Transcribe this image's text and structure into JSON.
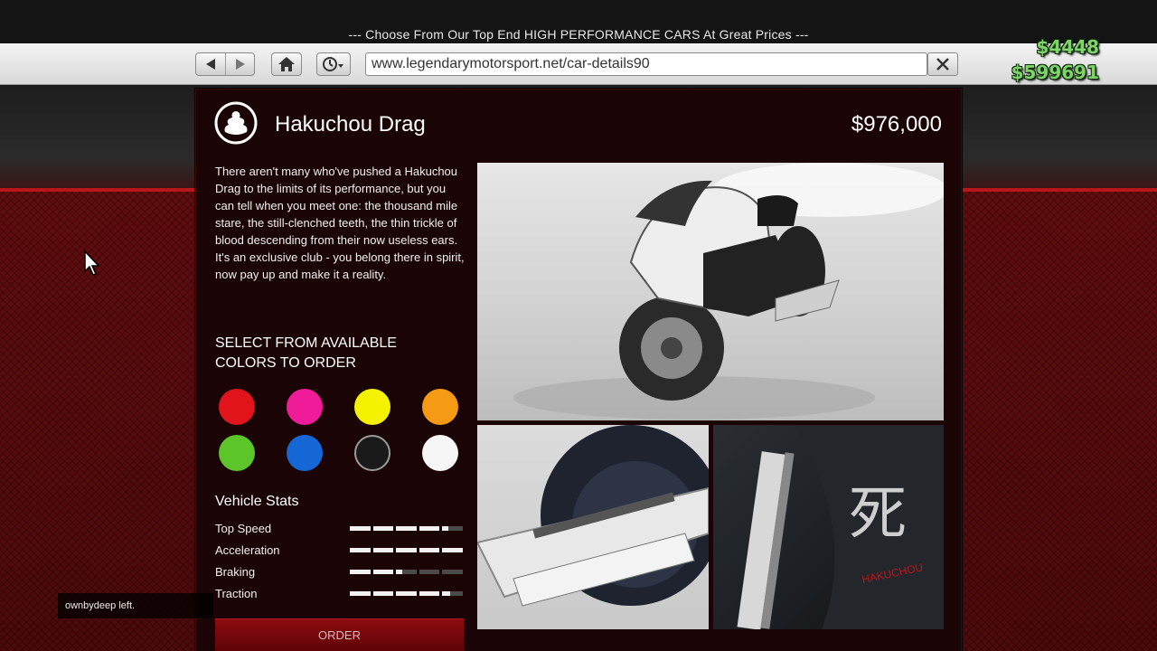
{
  "banner": {
    "text": "--- Choose From Our Top End HIGH PERFORMANCE CARS At Great Prices ---"
  },
  "browser": {
    "url": "www.legendarymotorsport.net/car-details90",
    "icons": [
      "back-arrow-icon",
      "forward-arrow-icon",
      "home-icon",
      "history-clock-icon",
      "close-icon"
    ]
  },
  "hud": {
    "cash": "$4448",
    "bank": "$599691"
  },
  "vehicle": {
    "name": "Hakuchou Drag",
    "price": "$976,000",
    "description": "There aren't many who've pushed a Hakuchou Drag to the limits of its performance, but you can tell when you meet one: the thousand mile stare, the still-clenched teeth, the thin trickle of blood descending from their now useless ears. It's an exclusive club - you belong there in spirit, now pay up and make it a reality."
  },
  "colors": {
    "heading": "SELECT FROM AVAILABLE COLORS TO ORDER",
    "swatches": [
      "#e0141a",
      "#ef1b99",
      "#f5f200",
      "#f59a12",
      "#5bc52a",
      "#1667d6",
      "#1a1a1a",
      "#f6f6f6"
    ]
  },
  "stats": {
    "heading": "Vehicle Stats",
    "items": [
      {
        "label": "Top Speed",
        "value": 0.86
      },
      {
        "label": "Acceleration",
        "value": 1.0
      },
      {
        "label": "Braking",
        "value": 0.46
      },
      {
        "label": "Traction",
        "value": 0.88
      }
    ]
  },
  "order": {
    "label": "ORDER"
  },
  "notification": {
    "text": "ownbydeep left."
  }
}
